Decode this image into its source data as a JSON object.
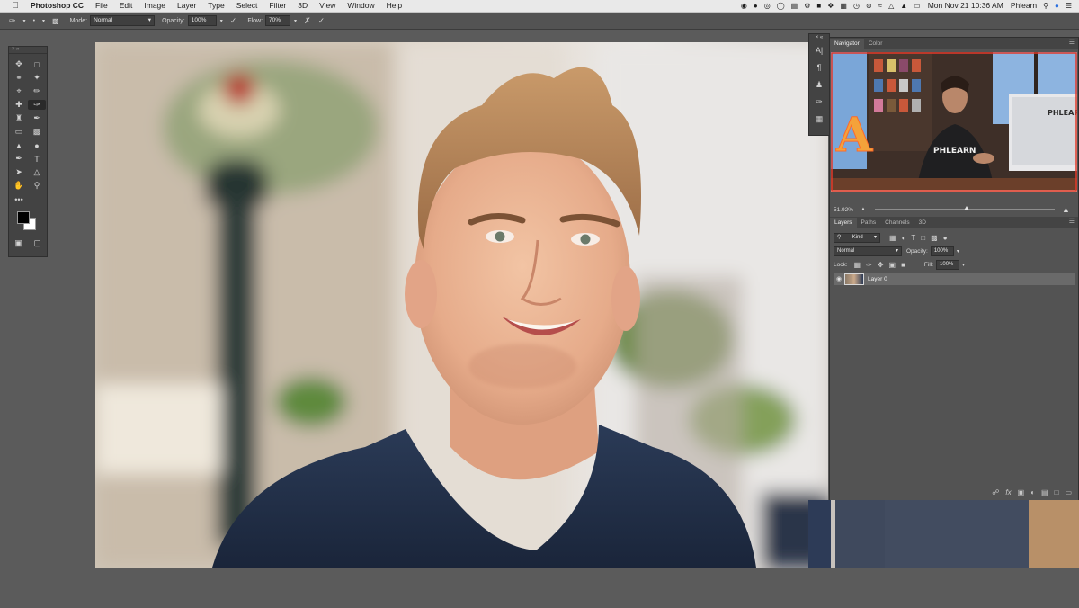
{
  "menubar": {
    "apple_icon": "apple-logo-icon",
    "app_name": "Photoshop CC",
    "menus": [
      "File",
      "Edit",
      "Image",
      "Layer",
      "Type",
      "Select",
      "Filter",
      "3D",
      "View",
      "Window",
      "Help"
    ],
    "clock": "Mon Nov 21  10:36 AM",
    "user": "Phlearn"
  },
  "options": {
    "mode_label": "Mode:",
    "mode_value": "Normal",
    "opacity_label": "Opacity:",
    "opacity_value": "100%",
    "flow_label": "Flow:",
    "flow_value": "70%"
  },
  "navigator": {
    "tabs": [
      "Navigator",
      "Color"
    ],
    "zoom_value": "51.92%",
    "zoom_fraction": 0.51,
    "thumb_text_brand": "PHLEARN",
    "thumb_letter": "A"
  },
  "layers": {
    "tabs": [
      "Layers",
      "Paths",
      "Channels",
      "3D"
    ],
    "kind_value": "Kind",
    "blend_value": "Normal",
    "opacity_label": "Opacity:",
    "opacity_value": "100%",
    "lock_label": "Lock:",
    "fill_label": "Fill:",
    "fill_value": "100%",
    "items": [
      {
        "name": "Layer 0",
        "visible": true,
        "selected": true
      }
    ]
  },
  "colors": {
    "accent_selected_layer": "#6a6a6a",
    "panel_bg": "#535353",
    "foreground_swatch": "#000000",
    "background_swatch": "#ffffff"
  }
}
